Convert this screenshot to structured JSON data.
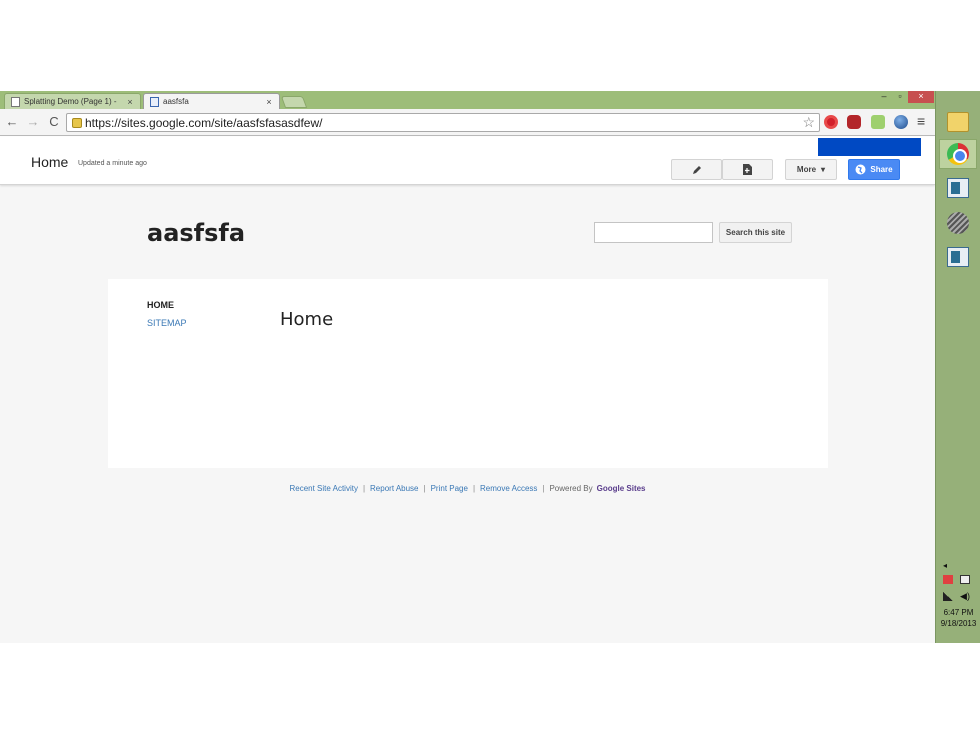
{
  "browser": {
    "tabs": [
      {
        "label": "Splatting Demo (Page 1) -",
        "close": "×",
        "active": false
      },
      {
        "label": "aasfsfa",
        "close": "×",
        "active": true
      }
    ],
    "window_controls": {
      "minimize": "–",
      "restore": "▫",
      "close": "×"
    },
    "url": "https://sites.google.com/site/aasfsfasasdfew/",
    "nav": {
      "back": "←",
      "forward": "→",
      "reload": "C"
    },
    "star_icon": "☆",
    "menu_icon": "≡",
    "extensions": [
      "opera-icon",
      "red-extension-icon",
      "green-extension-icon",
      "globe-icon"
    ]
  },
  "sites_header": {
    "page_title": "Home",
    "updated": "Updated a minute ago",
    "more_label": "More",
    "more_caret": "▾",
    "share_label": "Share"
  },
  "site": {
    "name": "aasfsfa",
    "search_placeholder": "",
    "search_button": "Search this site",
    "nav_items": [
      "HOME",
      "SITEMAP"
    ],
    "content_heading": "Home"
  },
  "footer": {
    "links": [
      "Recent Site Activity",
      "Report Abuse",
      "Print Page",
      "Remove Access"
    ],
    "separator": "|",
    "powered_by": "Powered By",
    "brand": "Google Sites"
  },
  "taskbar": {
    "items": [
      "file-explorer-icon",
      "chrome-icon",
      "window-app-icon",
      "orb-app-icon",
      "window-app-icon"
    ],
    "tray_arrow": "◂",
    "volume_icon": "◀)",
    "time": "6:47 PM",
    "date": "9/18/2013"
  },
  "colors": {
    "chrome_frame": "#9dbd79",
    "taskbar": "#96b079",
    "share_button": "#4a8af4",
    "link": "#3a78b5",
    "blue_bar": "#0049c3"
  }
}
